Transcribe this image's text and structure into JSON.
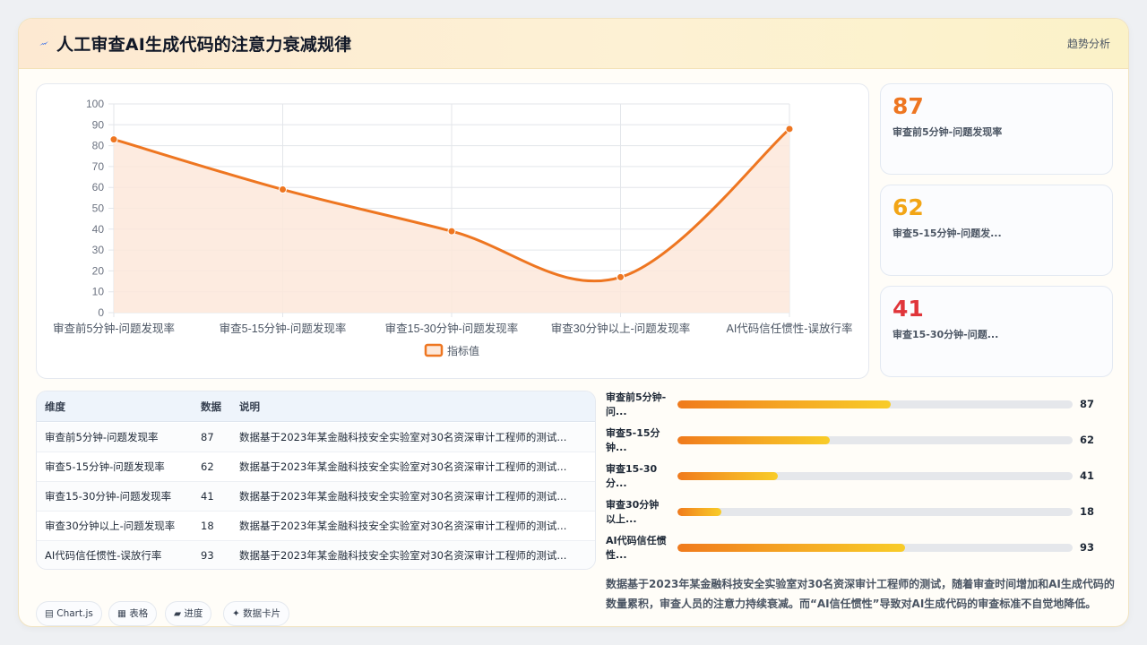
{
  "header": {
    "title": "人工审查AI生成代码的注意力衰减规律",
    "right_label": "趋势分析",
    "logo_icon": "spark-icon"
  },
  "chart_data": {
    "type": "line",
    "categories": [
      "审查前5分钟-问题发现率",
      "审查5-15分钟-问题发现率",
      "审查15-30分钟-问题发现率",
      "审查30分钟以上-问题发现率",
      "AI代码信任惯性-误放行率"
    ],
    "series": [
      {
        "name": "指标值",
        "values": [
          83,
          59,
          39,
          17,
          88
        ]
      }
    ],
    "y_ticks": [
      "0",
      "10",
      "20",
      "30",
      "40",
      "50",
      "60",
      "70",
      "80",
      "90",
      "100"
    ],
    "ylim": [
      0,
      100
    ],
    "grid": true,
    "legend": "bottom",
    "colors": {
      "line": "#ee7621",
      "fill": "#fde8da"
    }
  },
  "kpis": [
    {
      "value": "87",
      "label": "审查前5分钟-问题发现率",
      "color": "#ee7621"
    },
    {
      "value": "62",
      "label": "审查5-15分钟-问题发...",
      "color": "#f2a516"
    },
    {
      "value": "41",
      "label": "审查15-30分钟-问题...",
      "color": "#e0353a"
    }
  ],
  "table": {
    "headers": [
      "维度",
      "数据",
      "说明"
    ],
    "rows": [
      [
        "审查前5分钟-问题发现率",
        "87",
        "数据基于2023年某金融科技安全实验室对30名资深审计工程师的测试..."
      ],
      [
        "审查5-15分钟-问题发现率",
        "62",
        "数据基于2023年某金融科技安全实验室对30名资深审计工程师的测试..."
      ],
      [
        "审查15-30分钟-问题发现率",
        "41",
        "数据基于2023年某金融科技安全实验室对30名资深审计工程师的测试..."
      ],
      [
        "审查30分钟以上-问题发现率",
        "18",
        "数据基于2023年某金融科技安全实验室对30名资深审计工程师的测试..."
      ],
      [
        "AI代码信任惯性-误放行率",
        "93",
        "数据基于2023年某金融科技安全实验室对30名资深审计工程师的测试..."
      ]
    ]
  },
  "progress": [
    {
      "label": "审查前5分钟-问...",
      "value": "87",
      "pct": 54
    },
    {
      "label": "审查5-15分钟...",
      "value": "62",
      "pct": 38.5
    },
    {
      "label": "审查15-30分...",
      "value": "41",
      "pct": 25.5
    },
    {
      "label": "审查30分钟以上...",
      "value": "18",
      "pct": 11
    },
    {
      "label": "AI代码信任惯性...",
      "value": "93",
      "pct": 57.7
    }
  ],
  "note": "数据基于2023年某金融科技安全实验室对30名资深审计工程师的测试，随着审查时间增加和AI生成代码的数量累积，审查人员的注意力持续衰减。而“AI信任惯性”导致对AI生成代码的审查标准不自觉地降低。",
  "chips": [
    {
      "icon": "chart-icon",
      "glyph": "▤",
      "label": "Chart.js"
    },
    {
      "icon": "table-icon",
      "glyph": "▦",
      "label": "表格"
    },
    {
      "icon": "progress-icon",
      "glyph": "▰",
      "label": "进度"
    },
    {
      "icon": "sparkle-icon",
      "glyph": "✦",
      "label": "数据卡片"
    }
  ]
}
